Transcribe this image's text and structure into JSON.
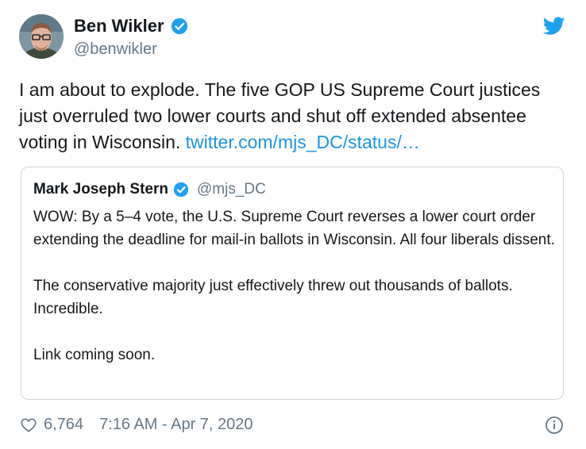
{
  "author": {
    "name": "Ben Wikler",
    "handle": "@benwikler",
    "verified": true
  },
  "tweet": {
    "text": "I am about to explode. The five GOP US Supreme Court justices just overruled two lower courts and shut off extended absentee voting in Wisconsin.",
    "link": "twitter.com/mjs_DC/status/…"
  },
  "quoted": {
    "name": "Mark Joseph Stern",
    "handle": "@mjs_DC",
    "verified": true,
    "paragraphs": [
      "WOW: By a 5–4 vote, the U.S. Supreme Court reverses a lower court order extending the deadline for mail-in ballots in Wisconsin. All four liberals dissent.",
      "The conservative majority just effectively threw out thousands of ballots. Incredible.",
      "Link coming soon."
    ]
  },
  "footer": {
    "likes": "6,764",
    "timestamp": "7:16 AM - Apr 7, 2020"
  },
  "colors": {
    "link": "#1b95e0",
    "verified": "#1da1f2",
    "muted": "#657786",
    "border": "#ccd6dd"
  },
  "icons": [
    "twitter-bird-icon",
    "verified-badge-icon",
    "heart-icon",
    "info-icon"
  ]
}
